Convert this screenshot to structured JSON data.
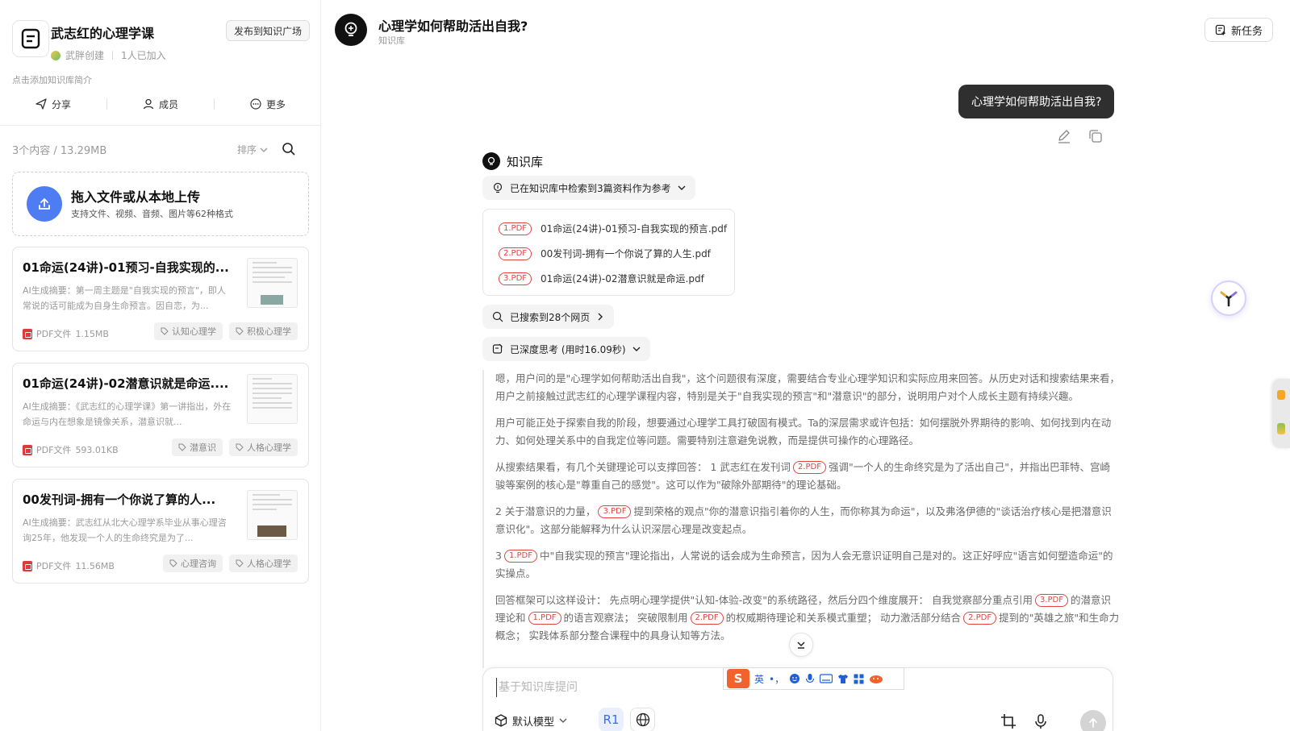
{
  "sidebar": {
    "kb_title": "武志红的心理学课",
    "creator": "武胖创建",
    "members_joined": "1人已加入",
    "publish_label": "发布到知识广场",
    "intro_placeholder": "点击添加知识库简介",
    "actions": {
      "share": "分享",
      "members": "成员",
      "more": "更多"
    },
    "content_count": "3个内容 / 13.29MB",
    "sort_label": "排序",
    "upload": {
      "title": "拖入文件或从本地上传",
      "subtitle": "支持文件、视频、音频、图片等62种格式"
    },
    "docs": [
      {
        "title": "01命运(24讲)-01预习-自我实现的...",
        "summary": "AI生成摘要：第一周主题是\"自我实现的预言\"，即人常说的话可能成为自身生命预言。因自恋，为...",
        "type_label": "PDF文件",
        "size": "1.15MB",
        "tags": [
          "认知心理学",
          "积极心理学"
        ]
      },
      {
        "title": "01命运(24讲)-02潜意识就是命运....",
        "summary": "AI生成摘要：《武志红的心理学课》第一讲指出，外在命运与内在想象是镜像关系，潜意识就...",
        "type_label": "PDF文件",
        "size": "593.01KB",
        "tags": [
          "潜意识",
          "人格心理学"
        ]
      },
      {
        "title": "00发刊词-拥有一个你说了算的人...",
        "summary": "AI生成摘要：武志红从北大心理学系毕业从事心理咨询25年，他发现一个人的生命终究是为了...",
        "type_label": "PDF文件",
        "size": "11.56MB",
        "tags": [
          "心理咨询",
          "人格心理学"
        ]
      }
    ]
  },
  "header": {
    "title": "心理学如何帮助活出自我?",
    "subtitle": "知识库",
    "new_task_label": "新任务"
  },
  "chat": {
    "user_message": "心理学如何帮助活出自我?",
    "assistant_label": "知识库",
    "retrieval_label": "已在知识库中检索到3篇资料作为参考",
    "references": [
      {
        "cite": "1.PDF",
        "name": "01命运(24讲)-01预习-自我实现的预言.pdf"
      },
      {
        "cite": "2.PDF",
        "name": "00发刊词-拥有一个你说了算的人生.pdf"
      },
      {
        "cite": "3.PDF",
        "name": "01命运(24讲)-02潜意识就是命运.pdf"
      }
    ],
    "web_search_label": "已搜索到28个网页",
    "deep_think_label": "已深度思考 (用时16.09秒)",
    "thinking": {
      "p1": "嗯，用户问的是\"心理学如何帮助活出自我\"，这个问题很有深度，需要结合专业心理学知识和实际应用来回答。从历史对话和搜索结果来看，用户之前接触过武志红的心理学课程内容，特别是关于\"自我实现的预言\"和\"潜意识\"的部分，说明用户对个人成长主题有持续兴趣。",
      "p2": "用户可能正处于探索自我的阶段，想要通过心理学工具打破固有模式。Ta的深层需求或许包括：如何摆脱外界期待的影响、如何找到内在动力、如何处理关系中的自我定位等问题。需要特别注意避免说教，而是提供可操作的心理路径。",
      "p3a": "从搜索结果看，有几个关键理论可以支撑回答：",
      "p3b": "1 武志红在发刊词",
      "p3c": "强调\"一个人的生命终究是为了活出自己\"，并指出巴菲特、宫崎骏等案例的核心是\"尊重自己的感觉\"。这可以作为\"破除外部期待\"的理论基础。",
      "p4a": "2 关于潜意识的力量，",
      "p4b": "提到荣格的观点\"你的潜意识指引着你的人生，而你称其为命运\"，以及弗洛伊德的\"谈话治疗核心是把潜意识意识化\"。这部分能解释为什么认识深层心理是改变起点。",
      "p5a": "3",
      "p5b": "中\"自我实现的预言\"理论指出，人常说的话会成为生命预言，因为人会无意识证明自己是对的。这正好呼应\"语言如何塑造命运\"的实操点。",
      "p6a": "回答框架可以这样设计： 先点明心理学提供\"认知-体验-改变\"的系统路径，然后分四个维度展开： 自我觉察部分重点引用",
      "p6b": "的潜意识理论和",
      "p6c": "的语言观察法； 突破限制",
      "p6d": "用",
      "p6e": "的权威期待理论和关系模式重塑； 动力激活部分结合",
      "p6f": "提到的\"英雄之旅\"和生命力概念； 实践体系部分整合课程中的具身认知等方法。",
      "cites": {
        "c1": "1.PDF",
        "c2": "2.PDF",
        "c3": "3.PDF"
      }
    }
  },
  "composer": {
    "placeholder": "基于知识库提问",
    "model_label": "默认模型",
    "r1_label": "R1"
  },
  "ime": {
    "logo": "S",
    "lang": "英",
    "punct": "•，"
  },
  "colors": {
    "accent": "#3b6bf0",
    "cite_red": "#e0463f",
    "bubble": "#2f2f2f",
    "upload_blue": "#4e7cf3"
  }
}
